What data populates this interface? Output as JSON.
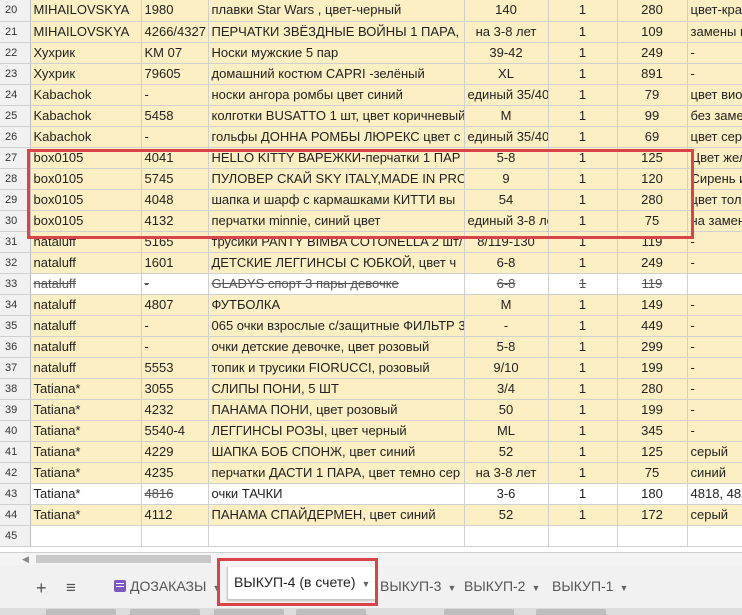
{
  "rows": [
    {
      "n": "20",
      "a": "MIHAILOVSKYA",
      "b": "1980",
      "c": "плавки Star Wars , цвет-черный",
      "d": "140",
      "e": "1",
      "f": "280",
      "g": "цвет-крас",
      "bg": "y"
    },
    {
      "n": "21",
      "a": "MIHAILOVSKYA",
      "b": "4266/4327",
      "c": "ПЕРЧАТКИ ЗВЁЗДНЫЕ ВОЙНЫ 1 ПАРА,",
      "d": "на 3-8 лет",
      "e": "1",
      "f": "109",
      "g": "замены н",
      "bg": "y"
    },
    {
      "n": "22",
      "a": "Хухрик",
      "b": "KM 07",
      "c": "Носки мужские 5 пар",
      "d": "39-42",
      "e": "1",
      "f": "249",
      "g": "-",
      "bg": "y"
    },
    {
      "n": "23",
      "a": "Хухрик",
      "b": "79605",
      "c": "домашний костюм CAPRI -зелёный",
      "d": "XL",
      "e": "1",
      "f": "891",
      "g": "-",
      "bg": "y"
    },
    {
      "n": "24",
      "a": "Kabachok",
      "b": "-",
      "c": "носки ангора ромбы цвет синий",
      "d": "единый 35/40",
      "e": "1",
      "f": "79",
      "g": "цвет виол",
      "bg": "y"
    },
    {
      "n": "25",
      "a": "Kabachok",
      "b": "5458",
      "c": "колготки BUSATTO 1 шт, цвет коричневый",
      "d": "M",
      "e": "1",
      "f": "99",
      "g": "без заме",
      "bg": "y"
    },
    {
      "n": "26",
      "a": "Kabachok",
      "b": "-",
      "c": "гольфы ДОННА РОМБЫ ЛЮРЕКС цвет с",
      "d": "единый 35/40",
      "e": "1",
      "f": "69",
      "g": "цвет сер",
      "bg": "y"
    },
    {
      "n": "27",
      "a": "box0105",
      "b": "4041",
      "c": "HELLO KITTY  ВАРЕЖКИ-перчатки 1 ПАР",
      "d": "5-8",
      "e": "1",
      "f": "125",
      "g": "Цвет жел",
      "bg": "y"
    },
    {
      "n": "28",
      "a": "box0105",
      "b": "5745",
      "c": "ПУЛОВЕР СКАЙ SKY ITALY,MADE IN PRO",
      "d": "9",
      "e": "1",
      "f": "120",
      "g": "Сирень и",
      "bg": "y"
    },
    {
      "n": "29",
      "a": "box0105",
      "b": "4048",
      "c": "шапка и шарф с кармашками КИТТИ  вы",
      "d": "54",
      "e": "1",
      "f": "280",
      "g": "цвет толь",
      "bg": "y"
    },
    {
      "n": "30",
      "a": "box0105",
      "b": "4132",
      "c": "перчатки minnie, синий цвет",
      "d": "единый 3-8 лет",
      "e": "1",
      "f": "75",
      "g": "на замен",
      "bg": "y"
    },
    {
      "n": "31",
      "a": "nataluff",
      "b": "5165",
      "c": "трусики PANTY BIMBA COTONELLA 2 шт/",
      "d": "8/119-130",
      "e": "1",
      "f": "119",
      "g": "-",
      "bg": "y"
    },
    {
      "n": "32",
      "a": "nataluff",
      "b": "1601",
      "c": "ДЕТСКИЕ ЛЕГГИНСЫ  С ЮБКОЙ, цвет ч",
      "d": "6-8",
      "e": "1",
      "f": "249",
      "g": "-",
      "bg": "y"
    },
    {
      "n": "33",
      "a": "nataluff",
      "b": "-",
      "c": "GLADYS спорт 3 пары девочке",
      "d": "6-8",
      "e": "1",
      "f": "119",
      "g": "",
      "bg": "w",
      "strike": true
    },
    {
      "n": "34",
      "a": "nataluff",
      "b": "4807",
      "c": "ФУТБОЛКА",
      "d": "M",
      "e": "1",
      "f": "149",
      "g": "-",
      "bg": "y"
    },
    {
      "n": "35",
      "a": "nataluff",
      "b": "-",
      "c": "065 очки взрослые с/защитные ФИЛЬТР 3",
      "d": "-",
      "e": "1",
      "f": "449",
      "g": "-",
      "bg": "y"
    },
    {
      "n": "36",
      "a": "nataluff",
      "b": "-",
      "c": "очки детские девочке, цвет розовый",
      "d": "5-8",
      "e": "1",
      "f": "299",
      "g": "-",
      "bg": "y"
    },
    {
      "n": "37",
      "a": "nataluff",
      "b": "5553",
      "c": "топик и трусики FIORUCCI, розовый",
      "d": "9/10",
      "e": "1",
      "f": "199",
      "g": "-",
      "bg": "y"
    },
    {
      "n": "38",
      "a": "Tatiana*",
      "b": "3055",
      "c": "СЛИПЫ ПОНИ, 5 ШТ",
      "d": "3/4",
      "e": "1",
      "f": "280",
      "g": "-",
      "bg": "y"
    },
    {
      "n": "39",
      "a": "Tatiana*",
      "b": "4232",
      "c": "ПАНАМА ПОНИ, цвет розовый",
      "d": "50",
      "e": "1",
      "f": "199",
      "g": "-",
      "bg": "y"
    },
    {
      "n": "40",
      "a": "Tatiana*",
      "b": "5540-4",
      "c": "ЛЕГГИНСЫ РОЗЫ, цвет черный",
      "d": "ML",
      "e": "1",
      "f": "345",
      "g": "-",
      "bg": "y"
    },
    {
      "n": "41",
      "a": "Tatiana*",
      "b": "4229",
      "c": "ШАПКА БОБ СПОНЖ, цвет синий",
      "d": "52",
      "e": "1",
      "f": "125",
      "g": "серый",
      "bg": "y"
    },
    {
      "n": "42",
      "a": "Tatiana*",
      "b": "4235",
      "c": "перчатки ДАСТИ 1 ПАРА, цвет темно сер",
      "d": "на 3-8 лет",
      "e": "1",
      "f": "75",
      "g": "синий",
      "bg": "y"
    },
    {
      "n": "43",
      "a": "Tatiana*",
      "b": "4816",
      "c": "очки ТАЧКИ",
      "d": "3-6",
      "e": "1",
      "f": "180",
      "g": "4818, 482",
      "bg": "w",
      "strikeB": true
    },
    {
      "n": "44",
      "a": "Tatiana*",
      "b": "4112",
      "c": "ПАНАМА СПАЙДЕРМЕН, цвет синий",
      "d": "52",
      "e": "1",
      "f": "172",
      "g": "серый",
      "bg": "y"
    },
    {
      "n": "45",
      "a": "",
      "b": "",
      "c": "",
      "d": "",
      "e": "",
      "f": "",
      "g": "",
      "bg": "w"
    }
  ],
  "tabs": {
    "add_icon": "+",
    "list_icon": "≡",
    "t1": "ДОЗАКАЗЫ",
    "t2": "ВЫКУП-4 (в счете)",
    "t3": "ВЫКУП-3",
    "t4": "ВЫКУП-2",
    "t5": "ВЫКУП-1"
  },
  "colors": {
    "row_highlight": "#fcefc4",
    "annotation": "#d9434a"
  }
}
